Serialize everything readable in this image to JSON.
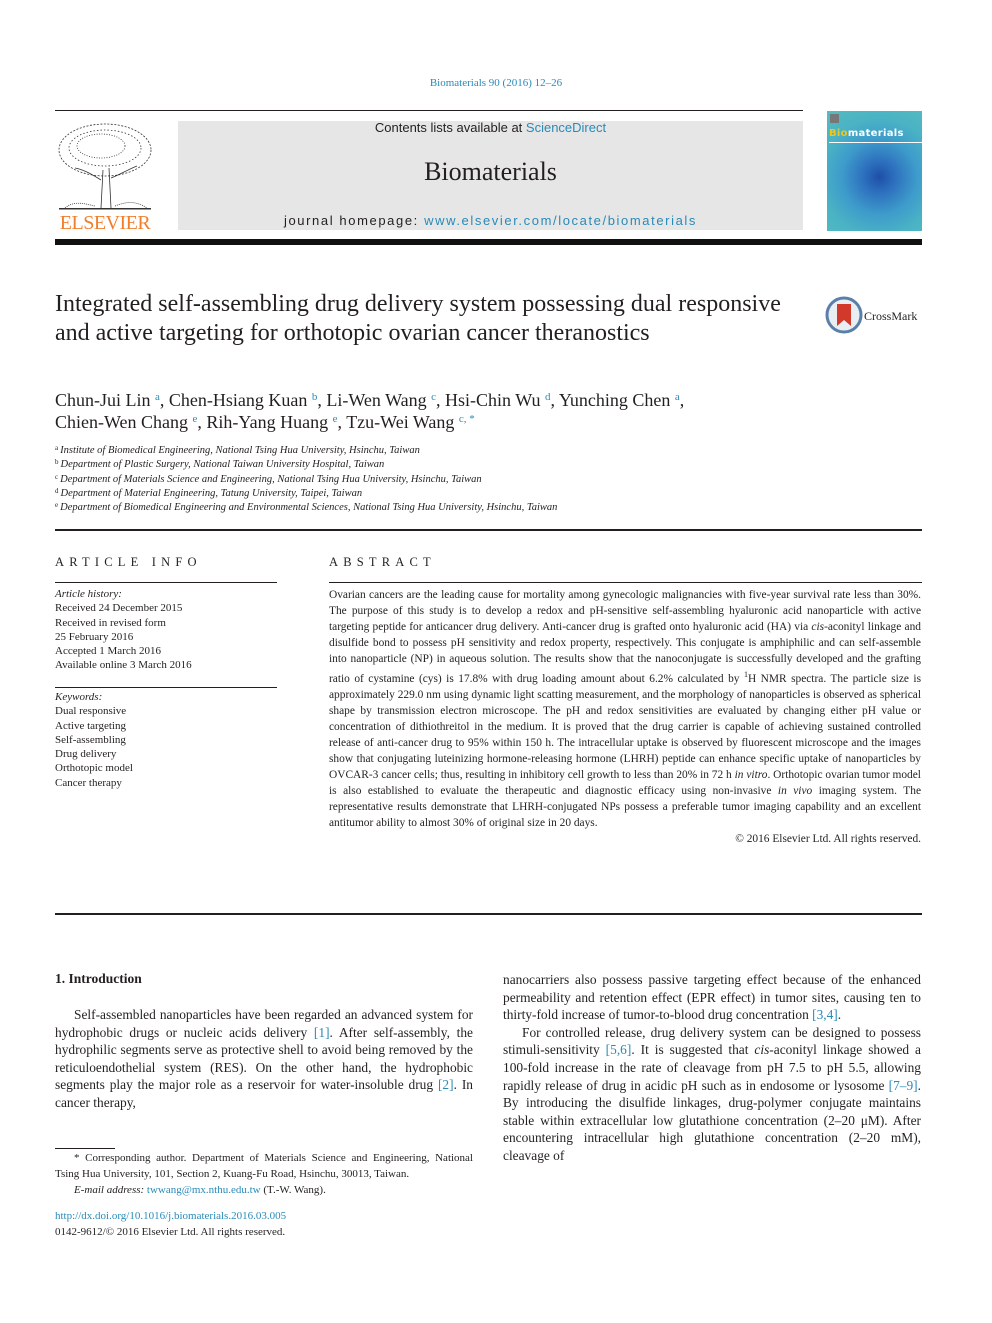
{
  "header": {
    "citation": "Biomaterials 90 (2016) 12–26",
    "contents_prefix": "Contents lists available at ",
    "contents_link": "ScienceDirect",
    "journal_name": "Biomaterials",
    "homepage_prefix": "journal homepage: ",
    "homepage_link": "www.elsevier.com/locate/biomaterials",
    "publisher_logo_text": "ELSEVIER",
    "cover_title_prefix": "Bio",
    "cover_title_rest": "materials",
    "brand_color": "#f07f2d",
    "link_color": "#2a8ab8"
  },
  "article": {
    "title": "Integrated self-assembling drug delivery system possessing dual responsive and active targeting for orthotopic ovarian cancer theranostics",
    "crossmark_label": "CrossMark",
    "authors": [
      {
        "name": "Chun-Jui Lin",
        "aff": "a",
        "sep": ", "
      },
      {
        "name": "Chen-Hsiang Kuan",
        "aff": "b",
        "sep": ", "
      },
      {
        "name": "Li-Wen Wang",
        "aff": "c",
        "sep": ", "
      },
      {
        "name": "Hsi-Chin Wu",
        "aff": "d",
        "sep": ", "
      },
      {
        "name": "Yunching Chen",
        "aff": "a",
        "sep": ","
      },
      {
        "name": "Chien-Wen Chang",
        "aff": "e",
        "sep": ", "
      },
      {
        "name": "Rih-Yang Huang",
        "aff": "e",
        "sep": ", "
      },
      {
        "name": "Tzu-Wei Wang",
        "aff": "c, *",
        "sep": ""
      }
    ],
    "affiliations": [
      {
        "key": "a",
        "text": "Institute of Biomedical Engineering, National Tsing Hua University, Hsinchu, Taiwan"
      },
      {
        "key": "b",
        "text": "Department of Plastic Surgery, National Taiwan University Hospital, Taiwan"
      },
      {
        "key": "c",
        "text": "Department of Materials Science and Engineering, National Tsing Hua University, Hsinchu, Taiwan"
      },
      {
        "key": "d",
        "text": "Department of Material Engineering, Tatung University, Taipei, Taiwan"
      },
      {
        "key": "e",
        "text": "Department of Biomedical Engineering and Environmental Sciences, National Tsing Hua University, Hsinchu, Taiwan"
      }
    ]
  },
  "article_info": {
    "heading": "ARTICLE INFO",
    "history_label": "Article history:",
    "history": [
      "Received 24 December 2015",
      "Received in revised form",
      "25 February 2016",
      "Accepted 1 March 2016",
      "Available online 3 March 2016"
    ],
    "keywords_label": "Keywords:",
    "keywords": [
      "Dual responsive",
      "Active targeting",
      "Self-assembling",
      "Drug delivery",
      "Orthotopic model",
      "Cancer therapy"
    ]
  },
  "abstract": {
    "heading": "ABSTRACT",
    "p1": "Ovarian cancers are the leading cause for mortality among gynecologic malignancies with five-year survival rate less than 30%. The purpose of this study is to develop a redox and pH-sensitive self-assembling hyaluronic acid nanoparticle with active targeting peptide for anticancer drug delivery. Anti-cancer drug is grafted onto hyaluronic acid (HA) via ",
    "p1_ital": "cis",
    "p2": "-aconityl linkage and disulfide bond to possess pH sensitivity and redox property, respectively. This conjugate is amphiphilic and can self-assemble into nanoparticle (NP) in aqueous solution. The results show that the nanoconjugate is successfully developed and the grafting ratio of cystamine (cys) is 17.8% with drug loading amount about 6.2% calculated by ",
    "p2_sup": "1",
    "p3": "H NMR spectra. The particle size is approximately 229.0 nm using dynamic light scatting measurement, and the morphology of nanoparticles is observed as spherical shape by transmission electron microscope. The pH and redox sensitivities are evaluated by changing either pH value or concentration of dithiothreitol in the medium. It is proved that the drug carrier is capable of achieving sustained controlled release of anti-cancer drug to 95% within 150 h. The intracellular uptake is observed by fluorescent microscope and the images show that conjugating luteinizing hormone-releasing hormone (LHRH) peptide can enhance specific uptake of nanoparticles by OVCAR-3 cancer cells; thus, resulting in inhibitory cell growth to less than 20% in 72 h ",
    "p3_ital": "in vitro",
    "p4": ". Orthotopic ovarian tumor model is also established to evaluate the therapeutic and diagnostic efficacy using non-invasive ",
    "p4_ital": "in vivo",
    "p5": " imaging system. The representative results demonstrate that LHRH-conjugated NPs possess a preferable tumor imaging capability and an excellent antitumor ability to almost 30% of original size in 20 days.",
    "copyright": "© 2016 Elsevier Ltd. All rights reserved."
  },
  "introduction": {
    "heading": "1. Introduction",
    "left_p1_a": "Self-assembled nanoparticles have been regarded an advanced system for hydrophobic drugs or nucleic acids delivery ",
    "ref1": "[1]",
    "left_p1_b": ". After self-assembly, the hydrophilic segments serve as protective shell to avoid being removed by the reticuloendothelial system (RES). On the other hand, the hydrophobic segments play the major role as a reservoir for water-insoluble drug ",
    "ref2": "[2]",
    "left_p1_c": ". In cancer therapy,",
    "right_p1_a": "nanocarriers also possess passive targeting effect because of the enhanced permeability and retention effect (EPR effect) in tumor sites, causing ten to thirty-fold increase of tumor-to-blood drug concentration ",
    "ref3": "[3,4]",
    "right_p1_b": ".",
    "right_p2_a": "For controlled release, drug delivery system can be designed to possess stimuli-sensitivity ",
    "ref4": "[5,6]",
    "right_p2_b": ". It is suggested that ",
    "right_p2_ital": "cis",
    "right_p2_c": "-aconityl linkage showed a 100-fold increase in the rate of cleavage from pH 7.5 to pH 5.5, allowing rapidly release of drug in acidic pH such as in endosome or lysosome ",
    "ref5": "[7–9]",
    "right_p2_d": ". By introducing the disulfide linkages, drug-polymer conjugate maintains stable within extracellular low glutathione concentration (2–20 μM). After encountering intracellular high glutathione concentration (2–20 mM), cleavage of"
  },
  "footnote": {
    "corresponding": "* Corresponding author. Department of Materials Science and Engineering, National Tsing Hua University, 101, Section 2, Kuang-Fu Road, Hsinchu, 30013, Taiwan.",
    "email_label": "E-mail address: ",
    "email": "twwang@mx.nthu.edu.tw",
    "email_suffix": " (T.-W. Wang)."
  },
  "publication": {
    "doi": "http://dx.doi.org/10.1016/j.biomaterials.2016.03.005",
    "issn": "0142-9612/© 2016 Elsevier Ltd. All rights reserved."
  }
}
